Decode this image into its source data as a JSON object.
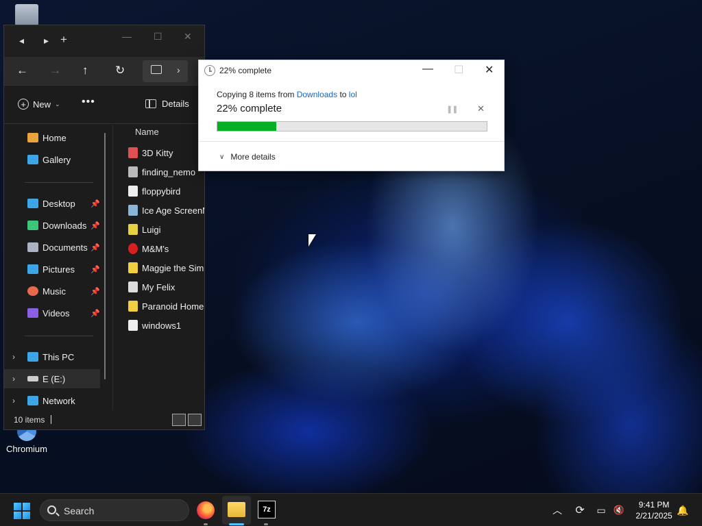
{
  "desktop": {
    "icons": [
      {
        "label": "Recycle Bin",
        "name": "recycle-bin-icon"
      },
      {
        "label": "Chromium",
        "name": "chromium-icon"
      }
    ]
  },
  "explorer": {
    "toolbar": {
      "new_label": "New",
      "details_label": "Details"
    },
    "nav": {
      "items": [
        {
          "label": "Home",
          "icon": "home-icon",
          "color": "#e8a33c"
        },
        {
          "label": "Gallery",
          "icon": "gallery-icon",
          "color": "#3ea6e8"
        },
        {
          "label": "Desktop",
          "icon": "desktop-icon",
          "color": "#3ea6e8",
          "pinned": true
        },
        {
          "label": "Downloads",
          "icon": "downloads-icon",
          "color": "#3cc77a",
          "pinned": true
        },
        {
          "label": "Documents",
          "icon": "documents-icon",
          "color": "#aab4c0",
          "pinned": true
        },
        {
          "label": "Pictures",
          "icon": "pictures-icon",
          "color": "#3ea6e8",
          "pinned": true
        },
        {
          "label": "Music",
          "icon": "music-icon",
          "color": "#e86a4c",
          "pinned": true
        },
        {
          "label": "Videos",
          "icon": "videos-icon",
          "color": "#8c5fe8",
          "pinned": true
        },
        {
          "label": "This PC",
          "icon": "this-pc-icon",
          "color": "#3ea6e8"
        },
        {
          "label": "E (E:)",
          "icon": "drive-icon",
          "color": "#cccccc",
          "selected": true
        },
        {
          "label": "Network",
          "icon": "network-icon",
          "color": "#3ea6e8"
        }
      ]
    },
    "files": {
      "column_header": "Name",
      "items": [
        {
          "label": "3D Kitty",
          "color": "#e05050"
        },
        {
          "label": "finding_nemo",
          "color": "#bbbbbb"
        },
        {
          "label": "floppybird",
          "color": "#eeeeee"
        },
        {
          "label": "Ice Age ScreenMa",
          "color": "#8ab4d8"
        },
        {
          "label": "Luigi",
          "color": "#e8d040"
        },
        {
          "label": "M&M's",
          "color": "#d82020"
        },
        {
          "label": "Maggie the Simps",
          "color": "#f0d040"
        },
        {
          "label": "My Felix",
          "color": "#dddddd"
        },
        {
          "label": "Paranoid Homer",
          "color": "#f0d040"
        },
        {
          "label": "windows1",
          "color": "#eeeeee"
        }
      ]
    },
    "status": {
      "count": "10 items"
    }
  },
  "copy_dialog": {
    "title": "22% complete",
    "copying_prefix": "Copying 8 items from",
    "source": "Downloads",
    "to_word": "to",
    "destination": "lol",
    "percent_label": "22% complete",
    "progress": 0.22,
    "more_details": "More details",
    "progress_color": "#06b025"
  },
  "taskbar": {
    "search_label": "Search",
    "time": "9:41 PM",
    "date": "2/21/2025",
    "sevenzip_label": "7z"
  }
}
